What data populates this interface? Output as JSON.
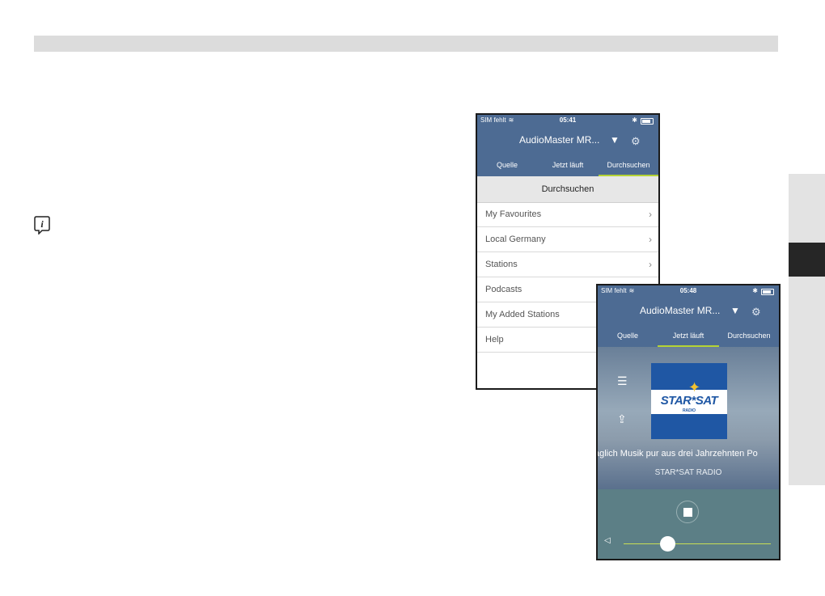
{
  "phone1": {
    "status": {
      "carrier": "SIM fehlt",
      "time": "05:41"
    },
    "device_name": "AudioMaster MR...",
    "tabs": [
      "Quelle",
      "Jetzt läuft",
      "Durchsuchen"
    ],
    "active_tab": "Durchsuchen",
    "section_title": "Durchsuchen",
    "items": [
      "My Favourites",
      "Local Germany",
      "Stations",
      "Podcasts",
      "My Added Stations",
      "Help"
    ]
  },
  "phone2": {
    "status": {
      "carrier": "SIM fehlt",
      "time": "05:48"
    },
    "device_name": "AudioMaster MR...",
    "tabs": [
      "Quelle",
      "Jetzt läuft",
      "Durchsuchen"
    ],
    "active_tab": "Jetzt läuft",
    "logo_text": "STAR*SAT",
    "logo_sub": "RADIO",
    "scroll_text": "aglich Musik pur aus drei Jahrzehnten Po",
    "station_name": "STAR*SAT RADIO",
    "volume_fraction": 0.3
  },
  "icons": {
    "info": "info-icon",
    "settings": "gear-icon",
    "dropdown": "triangle-down-icon",
    "playlist": "list-icon",
    "share": "share-icon",
    "stop": "stop-icon",
    "volume": "speaker-icon"
  },
  "colors": {
    "header": "#4d6b93",
    "tab_indicator": "#b5d334",
    "controls_bg": "#5c7f86",
    "logo_blue": "#1f57a4"
  }
}
